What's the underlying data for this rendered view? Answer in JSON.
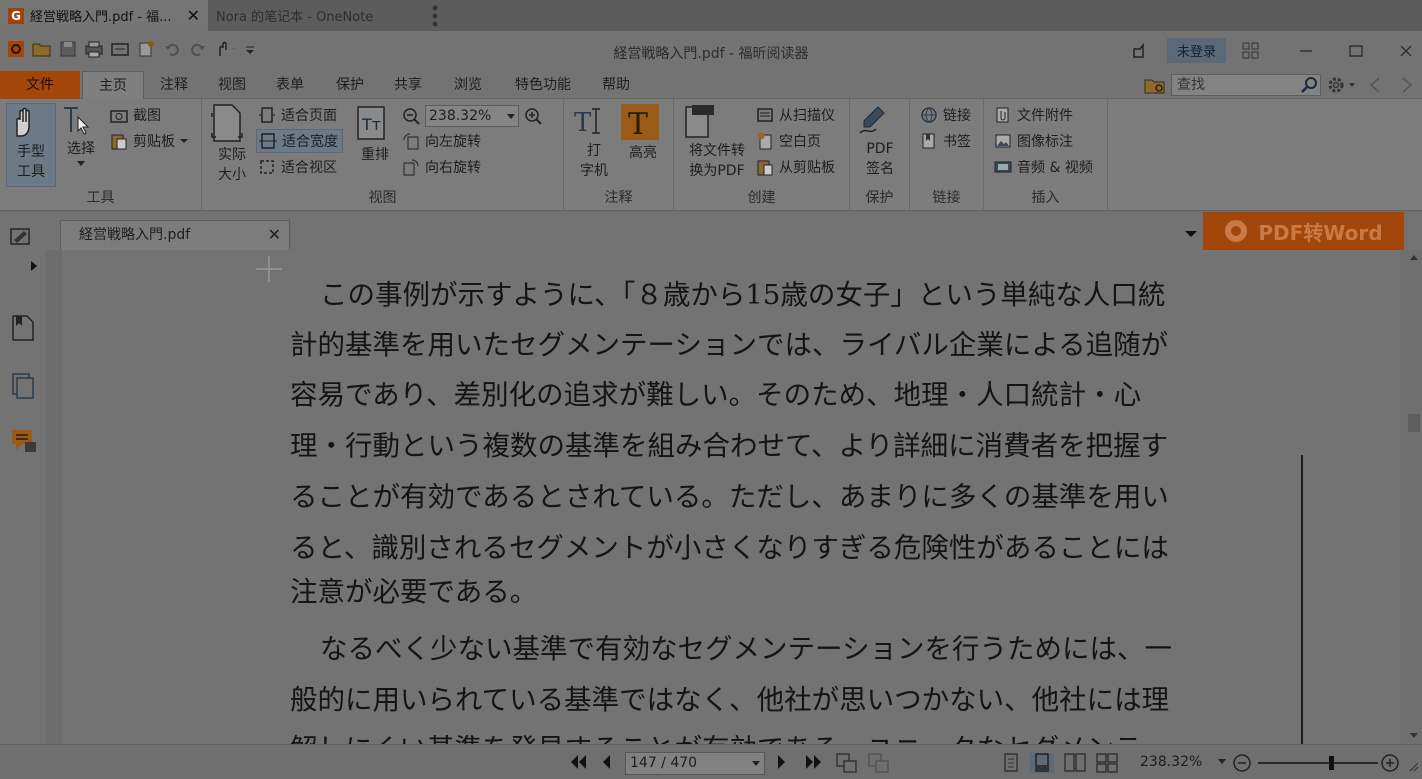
{
  "os_tabs": [
    {
      "label": "経営戦略入門.pdf - 福...",
      "active": true
    },
    {
      "label": "Nora 的笔记本 - OneNote",
      "active": false
    }
  ],
  "window": {
    "title": "経営戦略入門.pdf - 福昕阅读器",
    "login": "未登录"
  },
  "menu": [
    "文件",
    "主页",
    "注释",
    "视图",
    "表单",
    "保护",
    "共享",
    "浏览",
    "特色功能",
    "帮助"
  ],
  "search": {
    "placeholder": "查找"
  },
  "ribbon": {
    "tools": {
      "hand": "手型\n工具",
      "select": "选择",
      "screenshot": "截图",
      "clipboard": "剪贴板",
      "group": "工具"
    },
    "view": {
      "actual_size": "实际\n大小",
      "fit_page": "适合页面",
      "fit_width": "适合宽度",
      "fit_visible": "适合视区",
      "reflow": "重排",
      "zoom": "238.32%",
      "rotate_left": "向左旋转",
      "rotate_right": "向右旋转",
      "group": "视图"
    },
    "comment": {
      "typewriter": "打\n字机",
      "highlight": "高亮",
      "group": "注释"
    },
    "create": {
      "convert": "将文件转\n换为PDF",
      "from_scanner": "从扫描仪",
      "blank_page": "空白页",
      "from_clipboard": "从剪贴板",
      "group": "创建"
    },
    "protect": {
      "sign": "PDF\n签名",
      "group": "保护"
    },
    "links": {
      "link": "链接",
      "bookmark": "书签",
      "group": "链接"
    },
    "insert": {
      "attachment": "文件附件",
      "image_annot": "图像标注",
      "audio_video": "音频 & 视频",
      "group": "插入"
    }
  },
  "doc_tab": {
    "label": "経営戦略入門.pdf"
  },
  "promo": {
    "label": "PDF转Word"
  },
  "document": {
    "lines": [
      "この事例が示すように、「８歳から15歳の女子」という単純な人口統",
      "計的基準を用いたセグメンテーションでは、ライバル企業による追随が",
      "容易であり、差別化の追求が難しい。そのため、地理・人口統計・心",
      "理・行動という複数の基準を組み合わせて、より詳細に消費者を把握す",
      "ることが有効であるとされている。ただし、あまりに多くの基準を用い",
      "ると、識別されるセグメントが小さくなりすぎる危険性があることには",
      "注意が必要である。",
      "なるべく少ない基準で有効なセグメンテーションを行うためには、一",
      "般的に用いられている基準ではなく、他社が思いつかない、他社には理",
      "解しにくい基準を発見することが有効である。ユニークなセグメンテ"
    ]
  },
  "status": {
    "page": "147 / 470",
    "zoom": "238.32%",
    "zoom_slider_fraction": 0.62
  }
}
